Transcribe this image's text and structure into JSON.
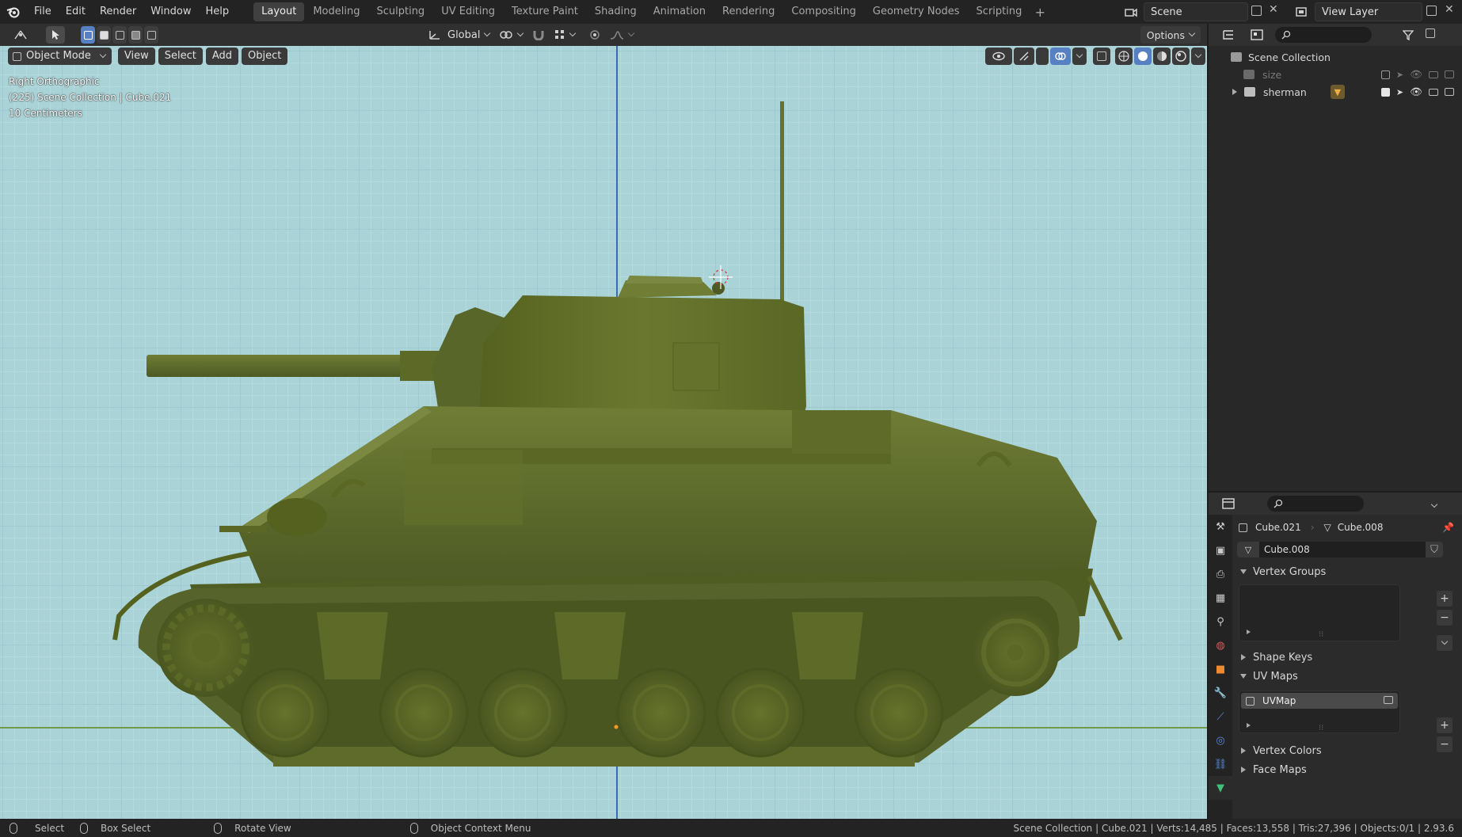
{
  "topbar": {
    "menus": [
      "File",
      "Edit",
      "Render",
      "Window",
      "Help"
    ],
    "workspaces": [
      "Layout",
      "Modeling",
      "Sculpting",
      "UV Editing",
      "Texture Paint",
      "Shading",
      "Animation",
      "Rendering",
      "Compositing",
      "Geometry Nodes",
      "Scripting"
    ],
    "active_workspace": "Layout",
    "scene_name": "Scene",
    "view_layer_name": "View Layer"
  },
  "viewport_header": {
    "transform_orientation": "Global",
    "options_label": "Options"
  },
  "viewport": {
    "mode": "Object Mode",
    "menus": [
      "View",
      "Select",
      "Add",
      "Object"
    ],
    "overlay_view": "Right Orthographic",
    "overlay_collection": "(225) Scene Collection | Cube.021",
    "overlay_scale": "10 Centimeters"
  },
  "outliner": {
    "root": "Scene Collection",
    "items": [
      {
        "name": "size",
        "enabled": false
      },
      {
        "name": "sherman",
        "enabled": true
      }
    ]
  },
  "properties": {
    "object_name": "Cube.021",
    "mesh_name": "Cube.008",
    "data_block": "Cube.008",
    "panels": {
      "vertex_groups": "Vertex Groups",
      "shape_keys": "Shape Keys",
      "uv_maps": "UV Maps",
      "vertex_colors": "Vertex Colors",
      "face_maps": "Face Maps"
    },
    "uv_map_name": "UVMap"
  },
  "statusbar": {
    "select": "Select",
    "box_select": "Box Select",
    "rotate_view": "Rotate View",
    "context_menu": "Object Context Menu",
    "stats": "Scene Collection | Cube.021 | Verts:14,485 | Faces:13,558 | Tris:27,396 | Objects:0/1 | 2.93.6"
  },
  "colors": {
    "viewport_bg": "#a9d3d7",
    "tank_green": "#5f6e2e",
    "active_blue": "#5680c2"
  }
}
